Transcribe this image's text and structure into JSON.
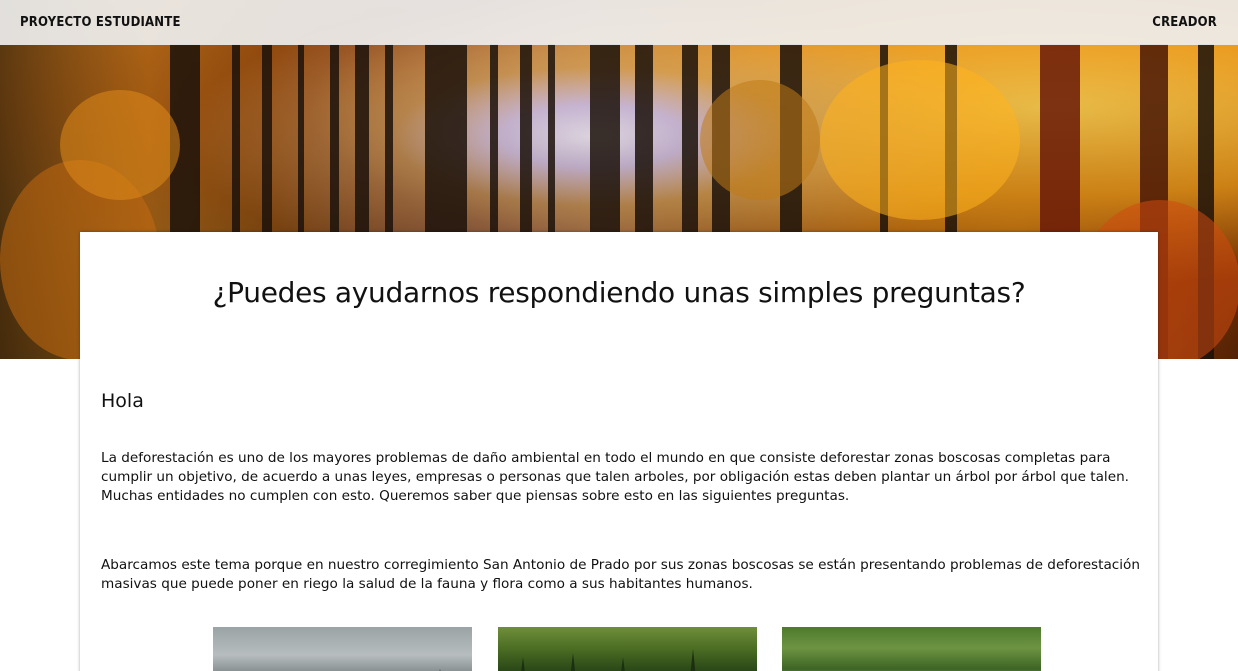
{
  "nav": {
    "brand": "PROYECTO ESTUDIANTE",
    "creator_link": "CREADOR"
  },
  "hero": {
    "image": "forest-autumn-sunlight"
  },
  "card": {
    "title": "¿Puedes ayudarnos respondiendo unas simples preguntas?",
    "greeting": "Hola",
    "paragraph_1": "La deforestación es uno de los mayores problemas de daño ambiental en todo el mundo en que consiste deforestar zonas boscosas completas para cumplir un objetivo, de acuerdo a unas leyes, empresas o personas que talen arboles, por obligación estas deben plantar un árbol por árbol que talen. Muchas entidades no cumplen con esto. Queremos saber que piensas sobre esto en las siguientes preguntas.",
    "paragraph_2": "Abarcamos este tema porque en nuestro corregimiento San Antonio de Prado por sus zonas boscosas se están presentando problemas de deforestación masivas que puede poner en riego la salud de la fauna y flora como a sus habitantes humanos."
  },
  "thumbnails": [
    {
      "image": "misty-forest-photo"
    },
    {
      "image": "pine-forest-photo"
    },
    {
      "image": "green-forest-photo"
    }
  ],
  "colors": {
    "topbar_bg": "#eeeeee",
    "text": "#111111",
    "card_bg": "#ffffff"
  }
}
